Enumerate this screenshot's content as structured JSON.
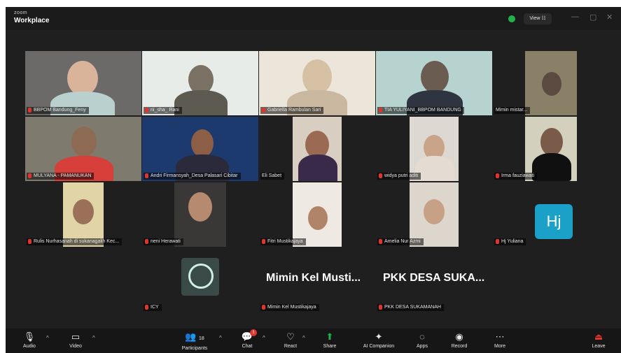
{
  "app": {
    "brand_small": "zoom",
    "brand_big": "Workplace",
    "view_label": "View ☷"
  },
  "colors": {
    "accent": "#1ba0c8",
    "mic_muted": "#e2342b",
    "secure": "#21b24b",
    "toolbar_bg": "#161616"
  },
  "participants": {
    "bbpom": "BBPOM Bandung_Feny",
    "nisrina": "ni_sha_ Rani",
    "gabriella": "Gabriella Rambulan Sari",
    "tia": "TIA YULIYANI_BBPOM BANDUNG",
    "mimin_mistar": "Mimin mistar...",
    "mulyana": "MULYANA - PAMANUKAN",
    "andri": "Andri Firmansyah_Desa Palasari Cibitar",
    "elisabet": "Eli Sabet",
    "widya": "widya putri aditi",
    "irma": "Irma fauziawati",
    "rulis": "Rulis Nurhasanah di sukanagalih Kec...",
    "neni": "neni Herawati",
    "fitri": "Fitri Mustikajaya",
    "amelia": "Amelia Nur Azmi",
    "hj_yuliana": "Hj Yuliana",
    "hj_initials": "Hj",
    "icy": "ICY",
    "mimin_kel_big": "Mimin Kel Musti...",
    "mimin_kel": "Mimin Kel Mustikajaya",
    "pkk_big": "PKK DESA SUKA...",
    "pkk": "PKK DESA SUKAMANAH"
  },
  "toolbar": {
    "audio": "Audio",
    "video": "Video",
    "participants": "Participants",
    "participants_count": "18",
    "chat": "Chat",
    "chat_badge": "1",
    "react": "React",
    "share": "Share",
    "ai": "AI Companion",
    "apps": "Apps",
    "record": "Record",
    "more": "More",
    "leave": "Leave"
  }
}
